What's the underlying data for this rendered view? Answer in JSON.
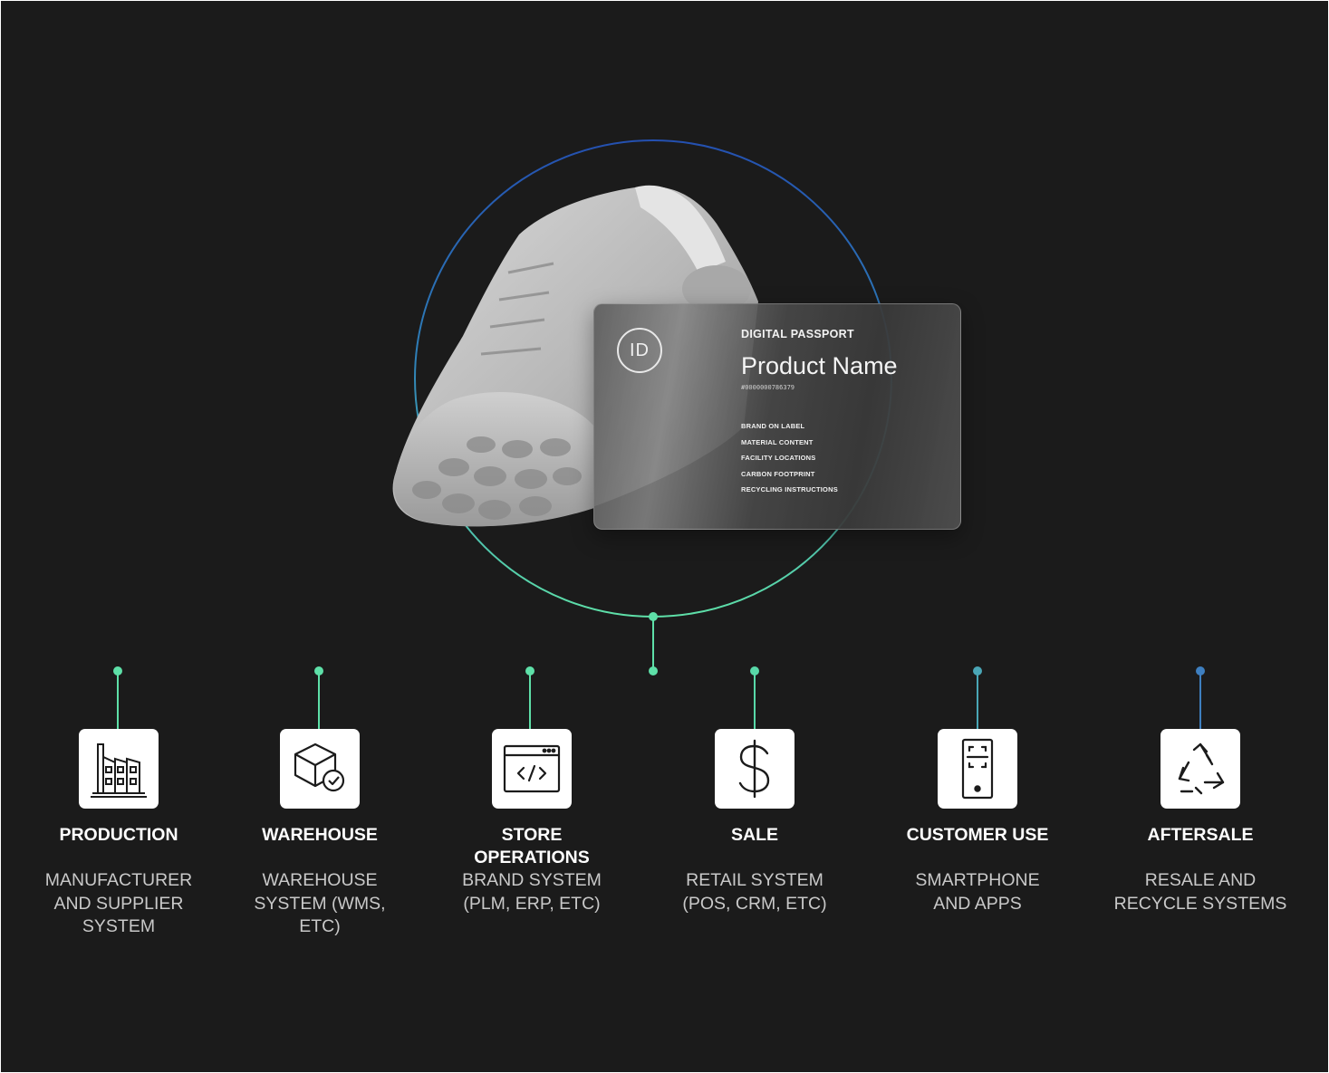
{
  "passport_card": {
    "id_badge": "ID",
    "kicker": "DIGITAL PASSPORT",
    "product_name": "Product Name",
    "serial": "#0000000786379",
    "fields": [
      "BRAND ON LABEL",
      "MATERIAL CONTENT",
      "FACILITY LOCATIONS",
      "CARBON FOOTPRINT",
      "RECYCLING INSTRUCTIONS"
    ]
  },
  "colors": {
    "background": "#1b1b1b",
    "connector_green": "#5ee0a8",
    "connector_blue": "#3e7fc0",
    "ring_top": "#2450b0"
  },
  "stages": [
    {
      "title_lines": [
        "PRODUCTION"
      ],
      "desc_lines": [
        "MANUFACTURER",
        "AND SUPPLIER",
        "SYSTEM"
      ],
      "icon": "factory-icon"
    },
    {
      "title_lines": [
        "WAREHOUSE"
      ],
      "desc_lines": [
        "WAREHOUSE",
        "SYSTEM (WMS,",
        "ETC)"
      ],
      "icon": "package-check-icon"
    },
    {
      "title_lines": [
        "STORE",
        "OPERATIONS"
      ],
      "desc_lines": [
        "BRAND SYSTEM",
        "(PLM, ERP, ETC)"
      ],
      "icon": "code-window-icon"
    },
    {
      "title_lines": [
        "SALE"
      ],
      "desc_lines": [
        "RETAIL SYSTEM",
        "(POS, CRM, ETC)"
      ],
      "icon": "dollar-icon"
    },
    {
      "title_lines": [
        "CUSTOMER USE"
      ],
      "desc_lines": [
        "SMARTPHONE",
        "AND APPS"
      ],
      "icon": "smartphone-scan-icon"
    },
    {
      "title_lines": [
        "AFTERSALE"
      ],
      "desc_lines": [
        "RESALE AND",
        "RECYCLE SYSTEMS"
      ],
      "icon": "recycle-icon"
    }
  ]
}
